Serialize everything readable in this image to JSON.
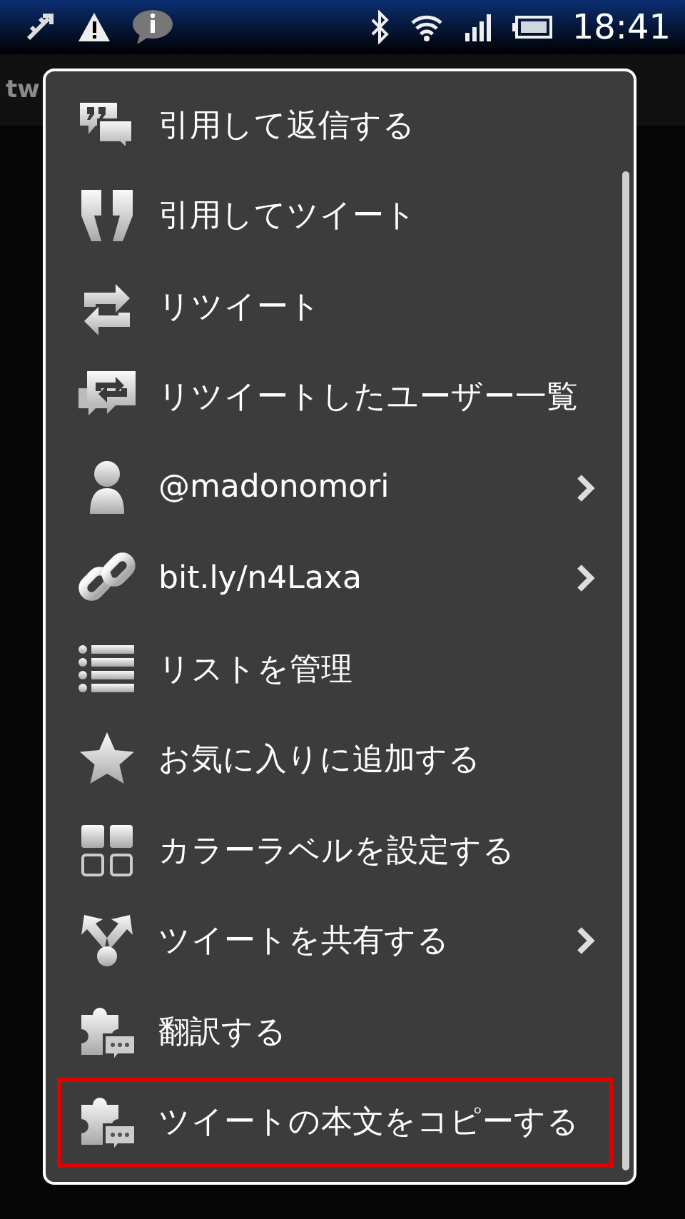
{
  "status_bar": {
    "time": "18:41"
  },
  "header": {
    "title": "tw"
  },
  "menu": {
    "items": [
      {
        "label": "引用して返信する",
        "submenu": false,
        "selected": false
      },
      {
        "label": "引用してツイート",
        "submenu": false,
        "selected": false
      },
      {
        "label": "リツイート",
        "submenu": false,
        "selected": false
      },
      {
        "label": "リツイートしたユーザー一覧",
        "submenu": false,
        "selected": false
      },
      {
        "label": "@madonomori",
        "submenu": true,
        "selected": false
      },
      {
        "label": "bit.ly/n4Laxa",
        "submenu": true,
        "selected": false
      },
      {
        "label": "リストを管理",
        "submenu": false,
        "selected": false
      },
      {
        "label": "お気に入りに追加する",
        "submenu": false,
        "selected": false
      },
      {
        "label": "カラーラベルを設定する",
        "submenu": false,
        "selected": false
      },
      {
        "label": "ツイートを共有する",
        "submenu": true,
        "selected": false
      },
      {
        "label": "翻訳する",
        "submenu": false,
        "selected": false
      },
      {
        "label": "ツイートの本文をコピーする",
        "submenu": false,
        "selected": true
      }
    ]
  }
}
